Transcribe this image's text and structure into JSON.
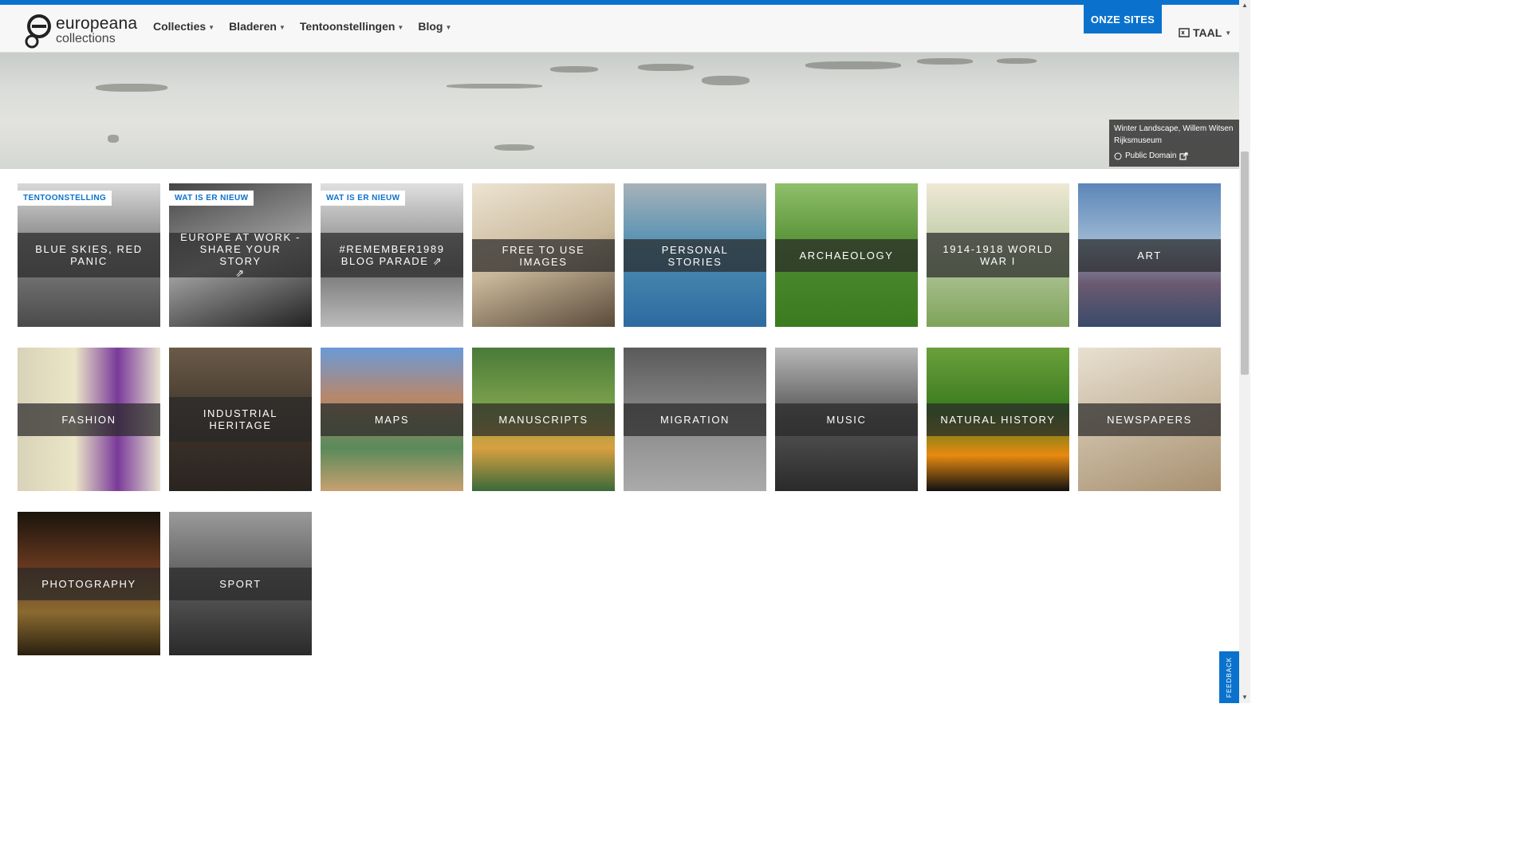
{
  "header": {
    "logo_line1": "europeana",
    "logo_line2": "collections",
    "nav": [
      "Collecties",
      "Bladeren",
      "Tentoonstellingen",
      "Blog"
    ],
    "onze_sites": "ONZE SITES",
    "language": "TAAL"
  },
  "hero_credit": {
    "line1": "Winter Landscape, Willem Witsen",
    "line2": "Rijksmuseum",
    "license": "Public Domain"
  },
  "tiles": [
    {
      "badge": "TENTOONSTELLING",
      "title": "BLUE SKIES, RED PANIC"
    },
    {
      "badge": "WAT IS ER NIEUW",
      "title": "EUROPE AT WORK - SHARE YOUR STORY"
    },
    {
      "badge": "WAT IS ER NIEUW",
      "title": "#REMEMBER1989 BLOG PARADE"
    },
    {
      "badge": "",
      "title": "FREE TO USE IMAGES"
    },
    {
      "badge": "",
      "title": "PERSONAL STORIES"
    },
    {
      "badge": "",
      "title": "ARCHAEOLOGY"
    },
    {
      "badge": "",
      "title": "1914-1918 WORLD WAR I"
    },
    {
      "badge": "",
      "title": "ART"
    },
    {
      "badge": "",
      "title": "FASHION"
    },
    {
      "badge": "",
      "title": "INDUSTRIAL HERITAGE"
    },
    {
      "badge": "",
      "title": "MAPS"
    },
    {
      "badge": "",
      "title": "MANUSCRIPTS"
    },
    {
      "badge": "",
      "title": "MIGRATION"
    },
    {
      "badge": "",
      "title": "MUSIC"
    },
    {
      "badge": "",
      "title": "NATURAL HISTORY"
    },
    {
      "badge": "",
      "title": "NEWSPAPERS"
    },
    {
      "badge": "",
      "title": "PHOTOGRAPHY"
    },
    {
      "badge": "",
      "title": "SPORT"
    }
  ],
  "feedback": "FEEDBACK",
  "colors": {
    "accent": "#0a72cc",
    "band": "rgba(40,40,40,0.72)"
  }
}
